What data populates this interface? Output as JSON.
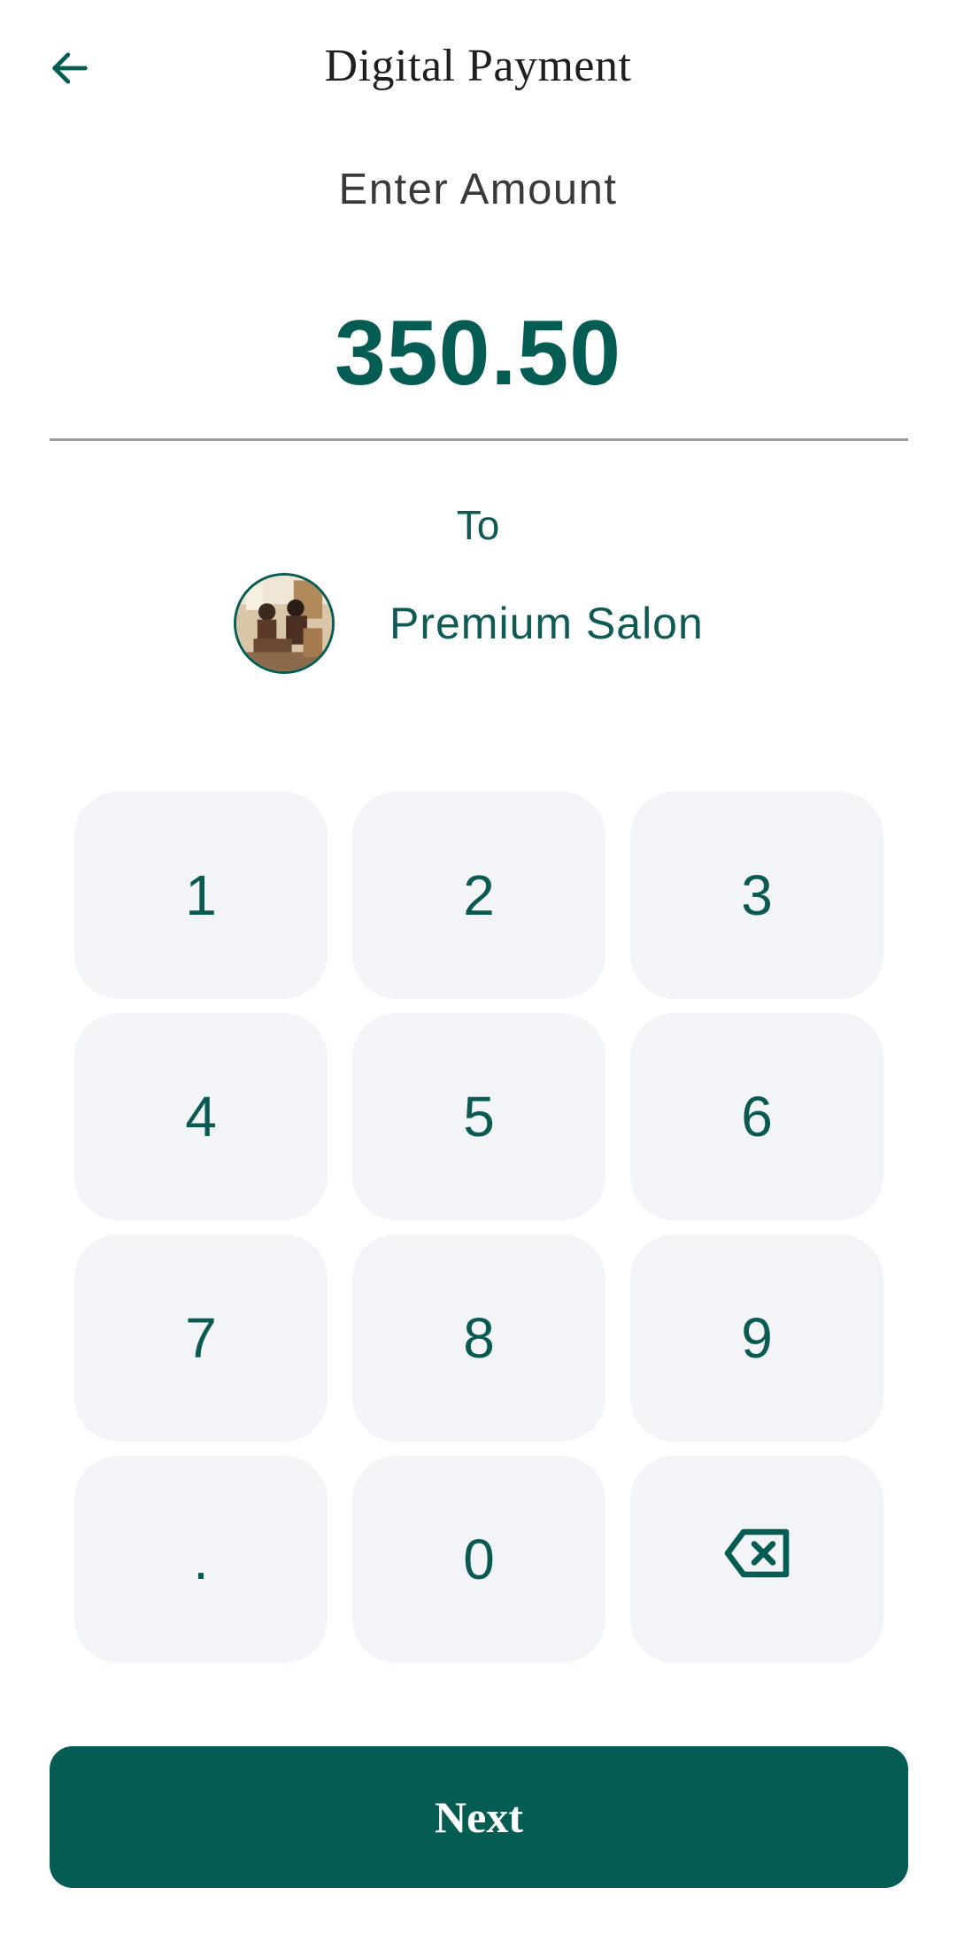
{
  "header": {
    "title": "Digital Payment",
    "back_icon": "arrow-left-icon"
  },
  "amount": {
    "label": "Enter Amount",
    "value": "350.50"
  },
  "recipient": {
    "to_label": "To",
    "name": "Premium Salon",
    "avatar_icon": "salon-avatar"
  },
  "keypad": {
    "keys": [
      "1",
      "2",
      "3",
      "4",
      "5",
      "6",
      "7",
      "8",
      "9",
      ".",
      "0"
    ],
    "backspace_icon": "backspace-icon"
  },
  "actions": {
    "next_label": "Next"
  },
  "colors": {
    "primary": "#045c52",
    "key_background": "#f3f4f8",
    "divider": "#9a9a9a"
  }
}
